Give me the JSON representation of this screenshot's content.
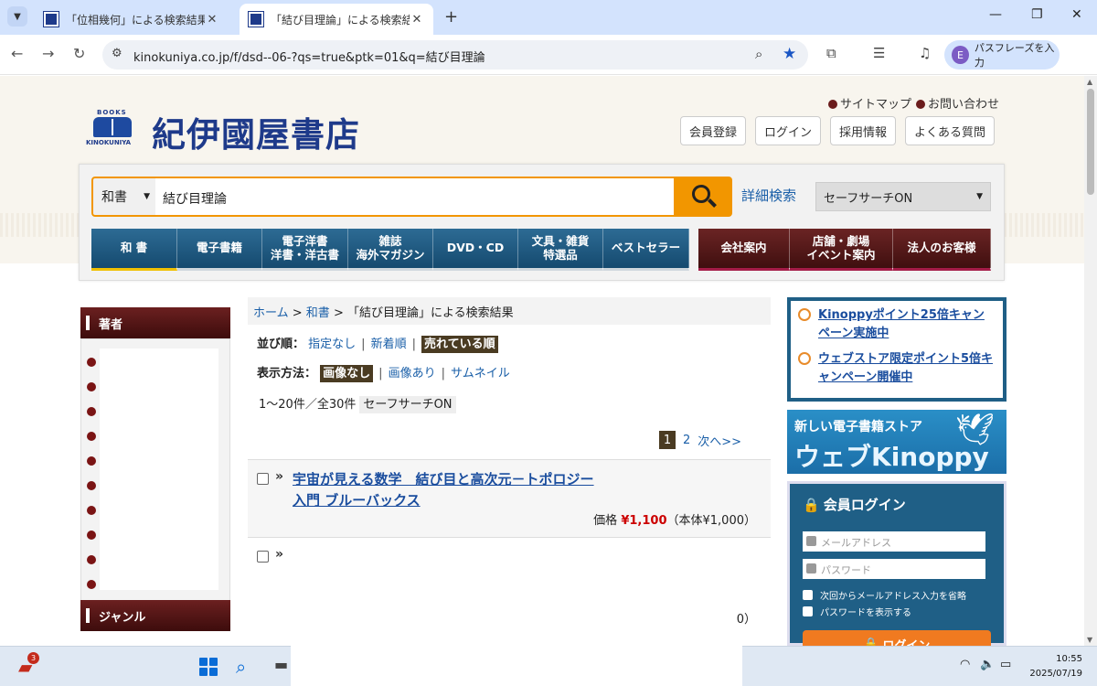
{
  "browser": {
    "tabs": [
      {
        "title": "「位相幾何」による検索結果 - 紀伊",
        "active": false
      },
      {
        "title": "「結び目理論」による検索結果 - 紀",
        "active": true
      }
    ],
    "new_tab": "+",
    "window_controls": {
      "minimize": "—",
      "restore": "❐",
      "close": "✕"
    },
    "url": "kinokuniya.co.jp/f/dsd--06-?qs=true&ptk=01&q=結び目理論",
    "profile_initial": "E",
    "passphrase_button": "パスフレーズを入力"
  },
  "header": {
    "logo_books": "BOOKS",
    "logo_kinokuniya": "KINOKUNIYA",
    "logo_text": "紀伊國屋書店",
    "top_links": [
      "サイトマップ",
      "お問い合わせ"
    ],
    "buttons": [
      "会員登録",
      "ログイン",
      "採用情報",
      "よくある質問"
    ]
  },
  "search": {
    "category": "和書",
    "query": "結び目理論",
    "advanced_label": "詳細検索",
    "safe_search": "セーフサーチON"
  },
  "global_nav": {
    "blue": [
      {
        "line1": "和 書",
        "line2": ""
      },
      {
        "line1": "電子書籍",
        "line2": ""
      },
      {
        "line1": "電子洋書",
        "line2": "洋書・洋古書"
      },
      {
        "line1": "雑誌",
        "line2": "海外マガジン"
      },
      {
        "line1": "DVD・CD",
        "line2": ""
      },
      {
        "line1": "文具・雑貨",
        "line2": "特選品"
      },
      {
        "line1": "ベストセラー",
        "line2": ""
      }
    ],
    "red": [
      {
        "line1": "会社案内",
        "line2": ""
      },
      {
        "line1": "店舗・劇場",
        "line2": "イベント案内"
      },
      {
        "line1": "法人のお客様",
        "line2": ""
      }
    ]
  },
  "sidebar": {
    "author_heading": "著者",
    "genre_heading": "ジャンル"
  },
  "breadcrumb": {
    "home": "ホーム",
    "sep": " > ",
    "category": "和書",
    "current": "「結び目理論」による検索結果"
  },
  "sort": {
    "label": "並び順：",
    "options": [
      "指定なし",
      "新着順"
    ],
    "active": "売れている順",
    "sep": "|"
  },
  "display": {
    "label": "表示方法：",
    "active": "画像なし",
    "options": [
      "画像あり",
      "サムネイル"
    ]
  },
  "results_count": "1〜20件／全30件",
  "results_safe": "セーフサーチON",
  "pager": {
    "current": "1",
    "next_page": "2",
    "next_label": "次へ>>"
  },
  "results": [
    {
      "title": "宇宙が見える数学　結び目と高次元－トポロジー入門 ブルーバックス",
      "price_label": "価格",
      "price": "¥1,100",
      "price_note": "（本体¥1,000）"
    },
    {
      "title": "",
      "price_label": "",
      "price": "",
      "price_note": "0）"
    }
  ],
  "campaigns": [
    "Kinoppyポイント25倍キャンペーン実施中",
    "ウェブストア限定ポイント5倍キャンペーン開催中"
  ],
  "kinoppy_banner": {
    "line1": "新しい電子書籍ストア",
    "line2": "ウェブKinoppy"
  },
  "login": {
    "title": "会員ログイン",
    "email_placeholder": "メールアドレス",
    "password_placeholder": "パスワード",
    "remember": "次回からメールアドレス入力を省略",
    "show_password": "パスワードを表示する",
    "button": "ログイン"
  },
  "taskbar": {
    "notification_count": "3",
    "time": "10:55",
    "date": "2025/07/19"
  }
}
